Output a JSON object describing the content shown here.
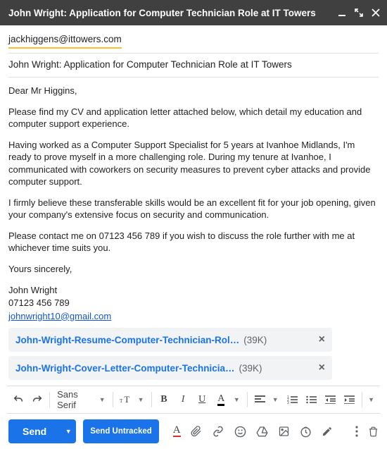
{
  "titlebar": {
    "title": "John Wright: Application for Computer Technician Role at IT Towers"
  },
  "to": "jackhiggens@ittowers.com",
  "subject": "John Wright: Application for Computer Technician Role at IT Towers",
  "body": {
    "greeting": "Dear Mr Higgins,",
    "p1": "Please find my CV and application letter attached below, which detail my education and computer support experience.",
    "p2": "Having worked as a Computer Support Specialist for 5 years at Ivanhoe Midlands, I'm ready to prove myself in a more challenging role. During my tenure at Ivanhoe, I communicated with coworkers on security measures to prevent cyber attacks and provide computer support.",
    "p3": "I firmly believe these transferable skills would be an excellent fit for your job opening, given your company's extensive focus on security and communication.",
    "p4": "Please contact me on 07123 456 789 if you wish to discuss the role further with me at whichever time suits you.",
    "closing": "Yours sincerely,",
    "sig_name": "John Wright",
    "sig_phone": "07123 456 789",
    "sig_email": "johnwright10@gmail.com"
  },
  "attachments": [
    {
      "name": "John-Wright-Resume-Computer-Technician-Rol…",
      "size": "(39K)"
    },
    {
      "name": "John-Wright-Cover-Letter-Computer-Technicia…",
      "size": "(39K)"
    }
  ],
  "format_toolbar": {
    "font": "Sans Serif"
  },
  "actions": {
    "send": "Send",
    "send_untracked": "Send Untracked"
  }
}
